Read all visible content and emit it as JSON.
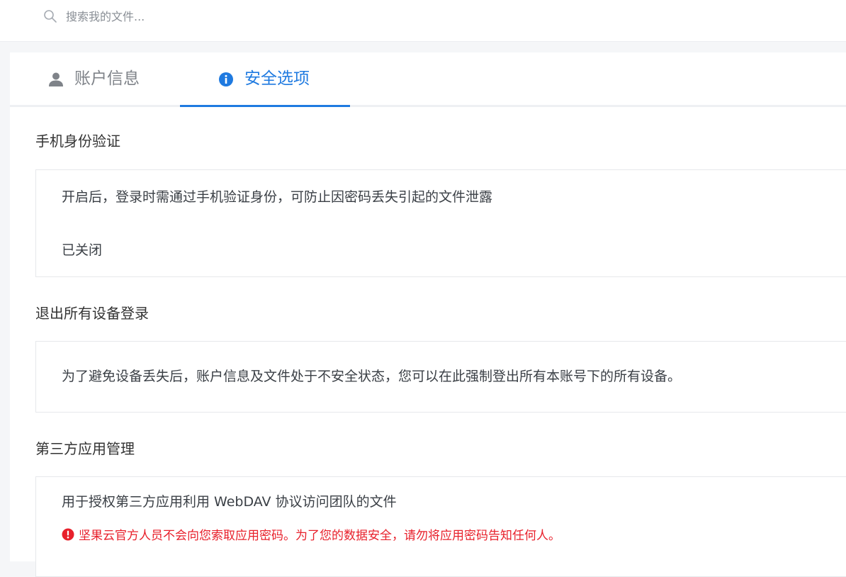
{
  "search": {
    "placeholder": "搜索我的文件..."
  },
  "tabs": [
    {
      "label": "账户信息",
      "icon": "user-icon",
      "active": false
    },
    {
      "label": "安全选项",
      "icon": "info-icon",
      "active": true
    }
  ],
  "sections": {
    "phone_verification": {
      "title": "手机身份验证",
      "description": "开启后，登录时需通过手机验证身份，可防止因密码丢失引起的文件泄露",
      "status": "已关闭"
    },
    "logout_devices": {
      "title": "退出所有设备登录",
      "description": "为了避免设备丢失后，账户信息及文件处于不安全状态，您可以在此强制登出所有本账号下的所有设备。"
    },
    "third_party": {
      "title": "第三方应用管理",
      "description": "用于授权第三方应用利用 WebDAV 协议访问团队的文件",
      "warning": "坚果云官方人员不会向您索取应用密码。为了您的数据安全，请勿将应用密码告知任何人。"
    }
  },
  "colors": {
    "accent": "#1f7ae0",
    "warning": "#e8202b",
    "muted": "#7f8389"
  }
}
